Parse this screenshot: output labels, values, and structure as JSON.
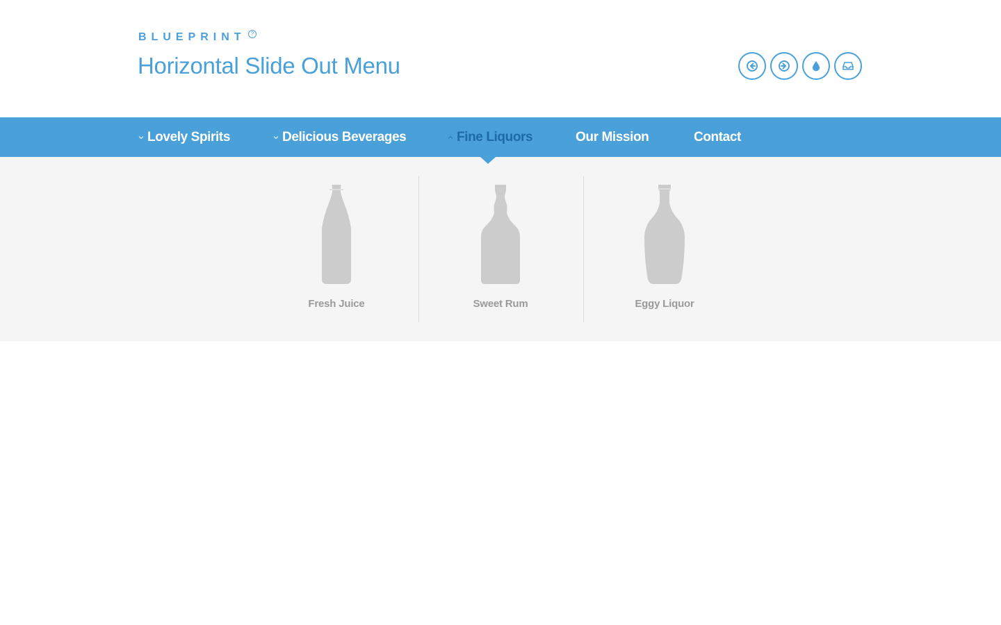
{
  "header": {
    "brand": "BLUEPRINT",
    "brand_mark": "?",
    "title": "Horizontal Slide Out Menu",
    "icon_buttons": [
      {
        "icon": "arrow-left-icon"
      },
      {
        "icon": "arrow-right-icon"
      },
      {
        "icon": "drop-icon"
      },
      {
        "icon": "inbox-icon"
      }
    ]
  },
  "nav": {
    "items": [
      {
        "label": "Lovely Spirits",
        "has_submenu": true,
        "active": false
      },
      {
        "label": "Delicious Beverages",
        "has_submenu": true,
        "active": false
      },
      {
        "label": "Fine Liquors",
        "has_submenu": true,
        "active": true
      },
      {
        "label": "Our Mission",
        "has_submenu": false,
        "active": false
      },
      {
        "label": "Contact",
        "has_submenu": false,
        "active": false
      }
    ]
  },
  "submenu": {
    "items": [
      {
        "label": "Fresh Juice",
        "icon": "bottle-icon"
      },
      {
        "label": "Sweet Rum",
        "icon": "rum-bottle-icon"
      },
      {
        "label": "Eggy Liquor",
        "icon": "liquor-bottle-icon"
      }
    ]
  },
  "colors": {
    "accent": "#4aa0d8",
    "active_nav": "#1e6aa6",
    "submenu_bg": "#f5f5f5",
    "bottle": "#cccccc",
    "sub_label": "#9a9a9a"
  }
}
